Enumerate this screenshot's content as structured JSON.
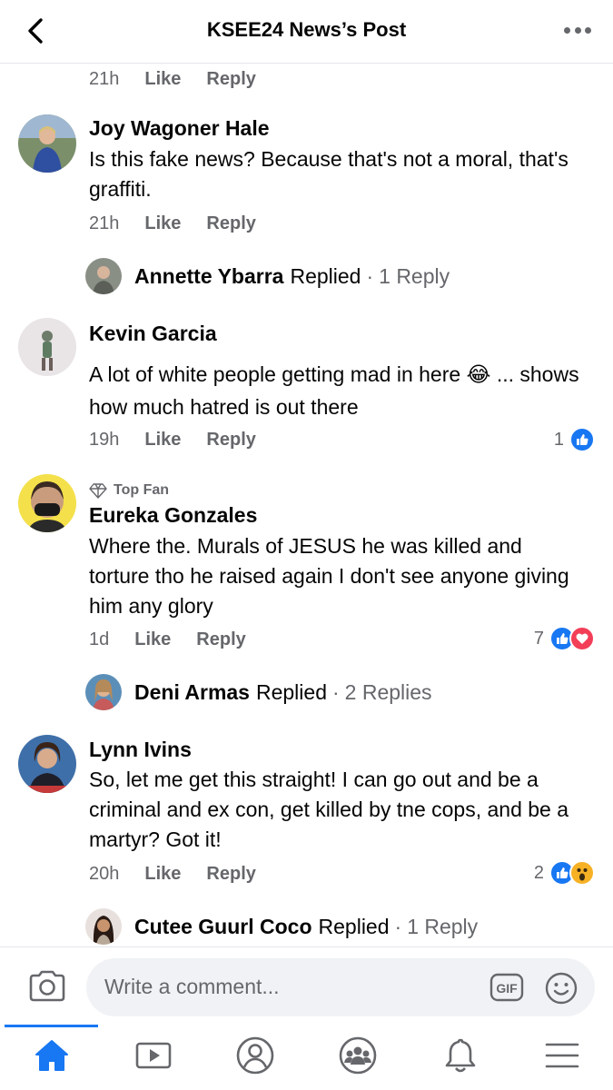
{
  "header": {
    "title": "KSEE24 News’s Post"
  },
  "actions": {
    "like": "Like",
    "reply": "Reply"
  },
  "top_meta": {
    "time": "21h"
  },
  "comments": [
    {
      "author": "Joy Wagoner Hale",
      "text": "Is this fake news? Because that's not a moral, that's graffiti.",
      "time": "21h",
      "reply_summary": {
        "name": "Annette Ybarra",
        "suffix": "Replied",
        "dot": "·",
        "count": "1 Reply"
      }
    },
    {
      "author": "Kevin Garcia",
      "text": "A lot of white people getting mad in here 😂 ... shows how much hatred is out there",
      "time": "19h",
      "reactions": {
        "count": "1",
        "types": [
          "like"
        ]
      }
    },
    {
      "badge": "Top Fan",
      "author": "Eureka Gonzales",
      "text": "Where the. Murals of JESUS he was killed and torture tho he raised again I don't see anyone giving him any glory",
      "time": "1d",
      "reactions": {
        "count": "7",
        "types": [
          "like",
          "love"
        ]
      },
      "reply_summary": {
        "name": "Deni Armas",
        "suffix": "Replied",
        "dot": "·",
        "count": "2 Replies"
      }
    },
    {
      "author": "Lynn Ivins",
      "text": "So, let me get this straight! I can go out and be a criminal and ex con, get killed by tne cops, and be a martyr? Got it!",
      "time": "20h",
      "reactions": {
        "count": "2",
        "types": [
          "like",
          "wow"
        ]
      },
      "reply_summary": {
        "name": "Cutee Guurl Coco",
        "suffix": "Replied",
        "dot": "·",
        "count": "1 Reply"
      }
    }
  ],
  "composer": {
    "placeholder": "Write a comment...",
    "gif": "GIF"
  },
  "nav": {
    "items": [
      "home-icon",
      "watch-icon",
      "profile-icon",
      "groups-icon",
      "notifications-icon",
      "menu-icon"
    ],
    "active": "home-icon"
  },
  "colors": {
    "accent": "#1877f2",
    "secondary_text": "#65676b",
    "input_bg": "#f0f2f5",
    "love": "#f33e58",
    "wow": "#f7b125"
  }
}
